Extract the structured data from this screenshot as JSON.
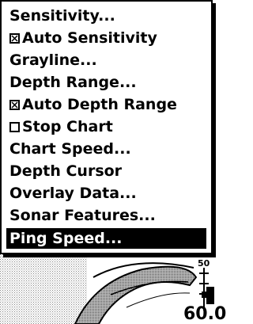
{
  "menu": {
    "items": [
      {
        "label": "Sensitivity...",
        "checkbox": false
      },
      {
        "label": "Auto Sensitivity",
        "checkbox": true,
        "checked": true
      },
      {
        "label": "Grayline...",
        "checkbox": false
      },
      {
        "label": "Depth Range...",
        "checkbox": false
      },
      {
        "label": "Auto Depth Range",
        "checkbox": true,
        "checked": true
      },
      {
        "label": "Stop Chart",
        "checkbox": true,
        "checked": false
      },
      {
        "label": "Chart Speed...",
        "checkbox": false
      },
      {
        "label": "Depth Cursor",
        "checkbox": false
      },
      {
        "label": "Overlay Data...",
        "checkbox": false
      },
      {
        "label": "Sonar Features...",
        "checkbox": false
      },
      {
        "label": "Ping Speed...",
        "checkbox": false,
        "selected": true
      }
    ]
  },
  "sonar": {
    "scale_top": "50",
    "depth": "60.0"
  }
}
